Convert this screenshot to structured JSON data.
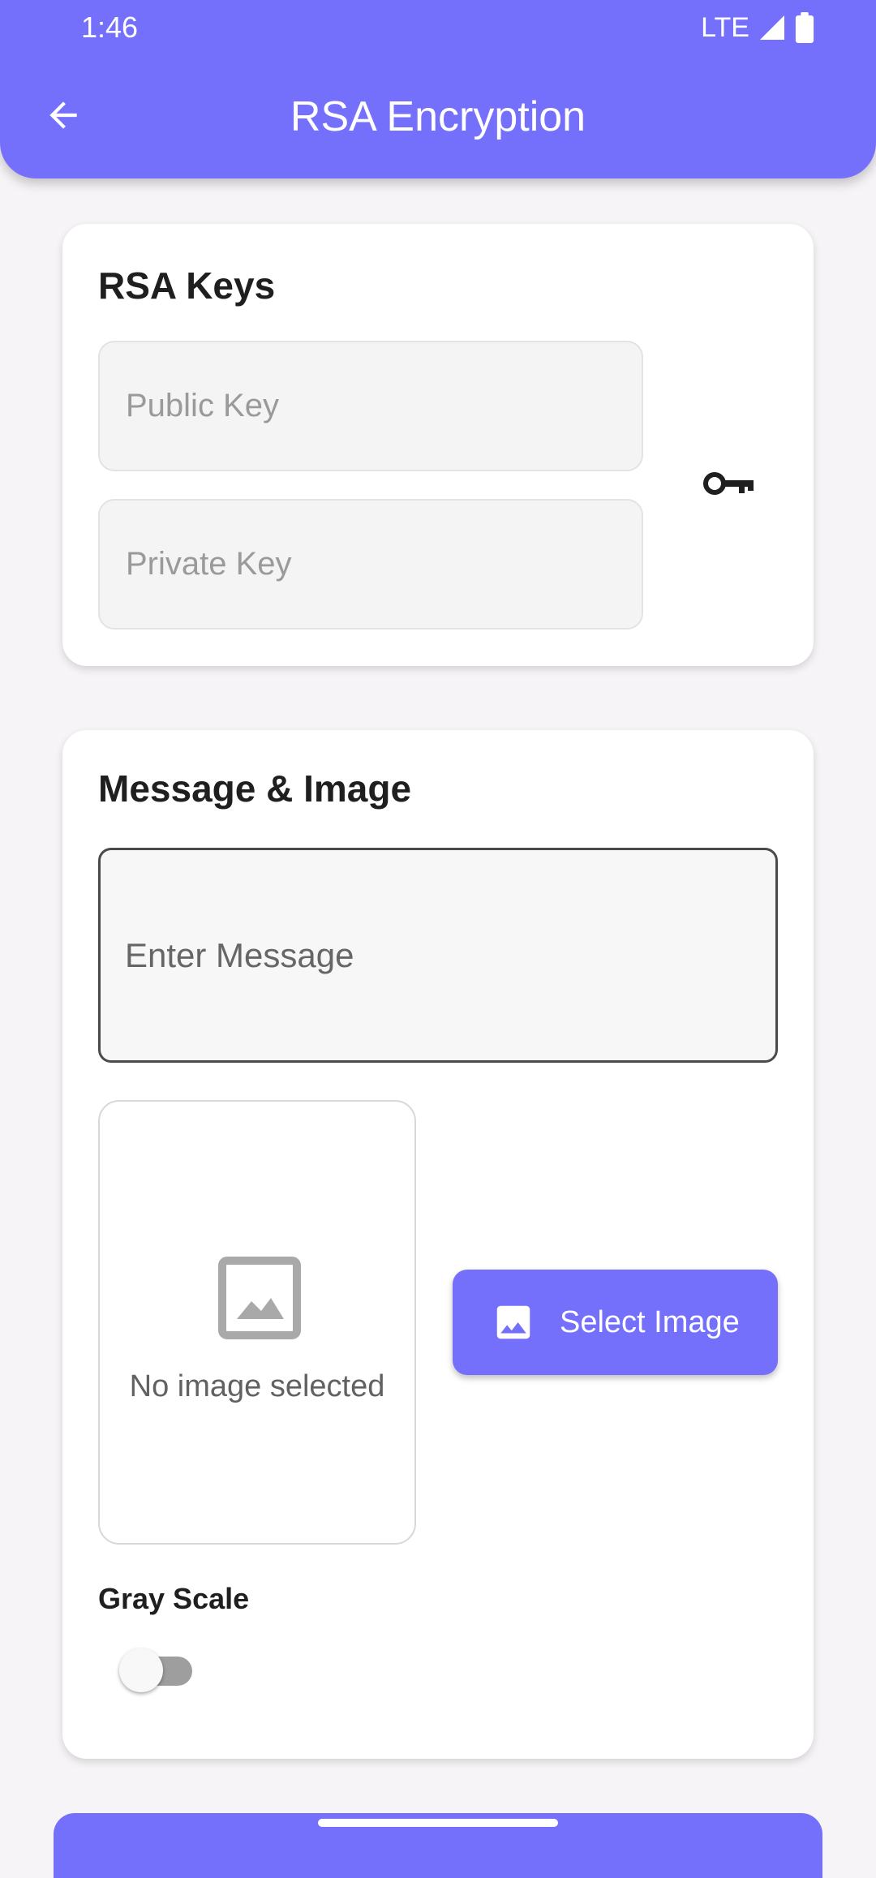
{
  "status_bar": {
    "time": "1:46",
    "network": "LTE"
  },
  "app_bar": {
    "title": "RSA Encryption",
    "back_icon": "arrow-back-icon",
    "color": "#7470fb"
  },
  "keys_card": {
    "title": "RSA Keys",
    "public_key": {
      "placeholder": "Public Key",
      "value": ""
    },
    "private_key": {
      "placeholder": "Private Key",
      "value": ""
    },
    "generate_icon": "key-icon"
  },
  "message_card": {
    "title": "Message & Image",
    "message_field": {
      "placeholder": "Enter Message",
      "value": ""
    },
    "image_preview": {
      "label": "No image selected",
      "icon": "image-placeholder-icon"
    },
    "select_button": {
      "label": "Select Image",
      "icon": "image-icon"
    },
    "gray_scale": {
      "label": "Gray Scale",
      "enabled": false
    }
  }
}
